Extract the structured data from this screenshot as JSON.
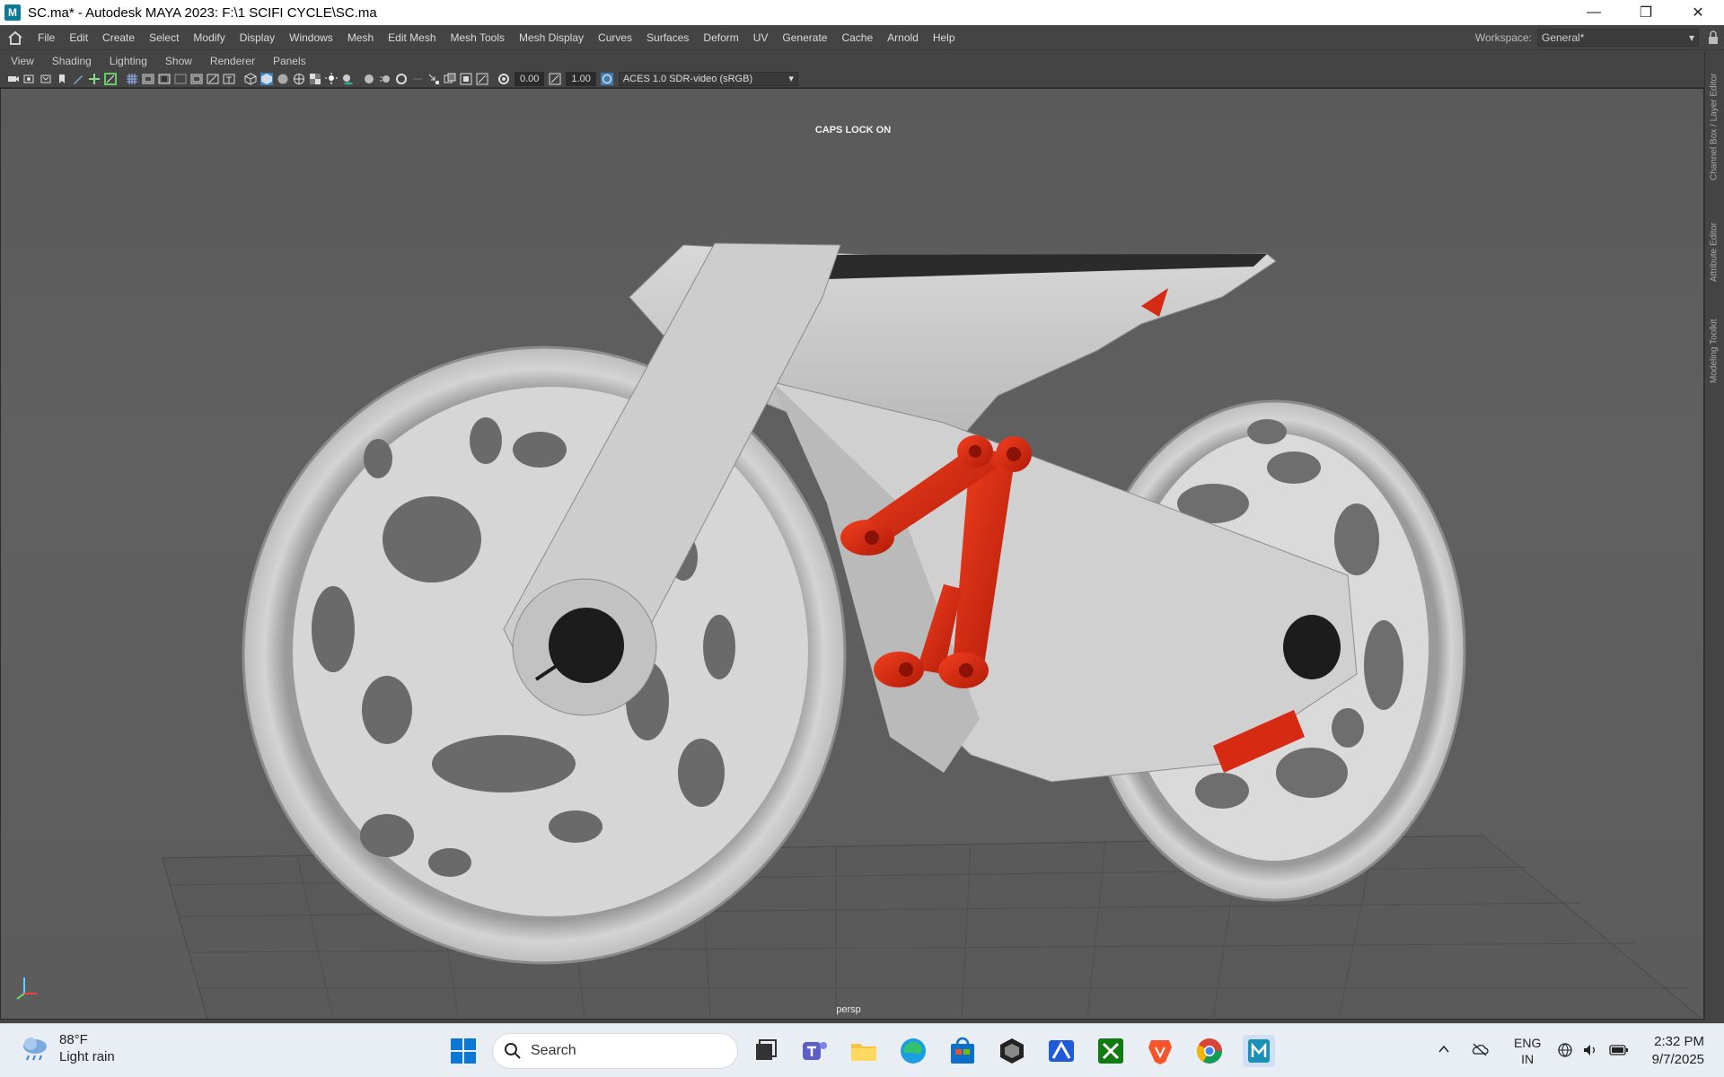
{
  "window": {
    "title": "SC.ma* - Autodesk MAYA 2023: F:\\1 SCIFI CYCLE\\SC.ma",
    "app_icon_letter": "M",
    "minimize": "—",
    "restore": "❐",
    "close": "✕"
  },
  "menu": {
    "items": [
      "File",
      "Edit",
      "Create",
      "Select",
      "Modify",
      "Display",
      "Windows",
      "Mesh",
      "Edit Mesh",
      "Mesh Tools",
      "Mesh Display",
      "Curves",
      "Surfaces",
      "Deform",
      "UV",
      "Generate",
      "Cache",
      "Arnold",
      "Help"
    ],
    "workspace_label": "Workspace:",
    "workspace_value": "General*"
  },
  "panel_menu": [
    "View",
    "Shading",
    "Lighting",
    "Show",
    "Renderer",
    "Panels"
  ],
  "toolbar": {
    "exposure": "0.00",
    "gamma": "1.00",
    "color_space": "ACES 1.0 SDR-video (sRGB)"
  },
  "viewport": {
    "caps_lock": "CAPS LOCK ON",
    "camera": "persp",
    "colors": {
      "background": "#5d5d5d",
      "model": "#c8c8c8",
      "suspension": "#d62a12",
      "grid": "#4a4a4a"
    }
  },
  "side_tabs": [
    "Channel Box / Layer Editor",
    "Attribute Editor",
    "Modeling Toolkit"
  ],
  "taskbar": {
    "weather_temp": "88°F",
    "weather_desc": "Light rain",
    "search_label": "Search",
    "apps": [
      "windows-start",
      "search",
      "task-view",
      "teams",
      "file-explorer",
      "edge",
      "store",
      "unity",
      "affinity",
      "xbox",
      "brave",
      "chrome",
      "maya"
    ],
    "lang": "ENG",
    "region": "IN",
    "time": "2:32 PM",
    "date": "9/7/2025"
  }
}
